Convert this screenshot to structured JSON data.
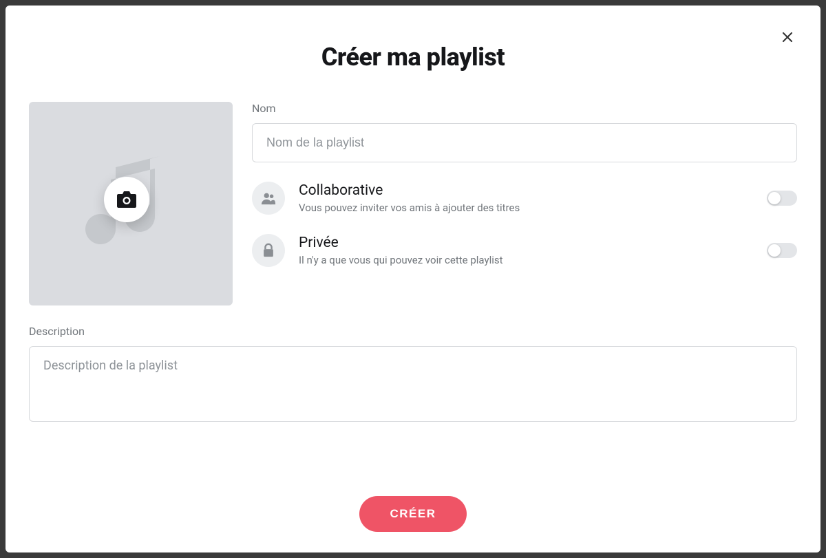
{
  "modal": {
    "title": "Créer ma playlist",
    "name_field": {
      "label": "Nom",
      "placeholder": "Nom de la playlist",
      "value": ""
    },
    "options": {
      "collaborative": {
        "title": "Collaborative",
        "description": "Vous pouvez inviter vos amis à ajouter des titres",
        "enabled": false
      },
      "private": {
        "title": "Privée",
        "description": "Il n'y a que vous qui pouvez voir cette playlist",
        "enabled": false
      }
    },
    "description_field": {
      "label": "Description",
      "placeholder": "Description de la playlist",
      "value": ""
    },
    "create_button": "CRÉER"
  }
}
